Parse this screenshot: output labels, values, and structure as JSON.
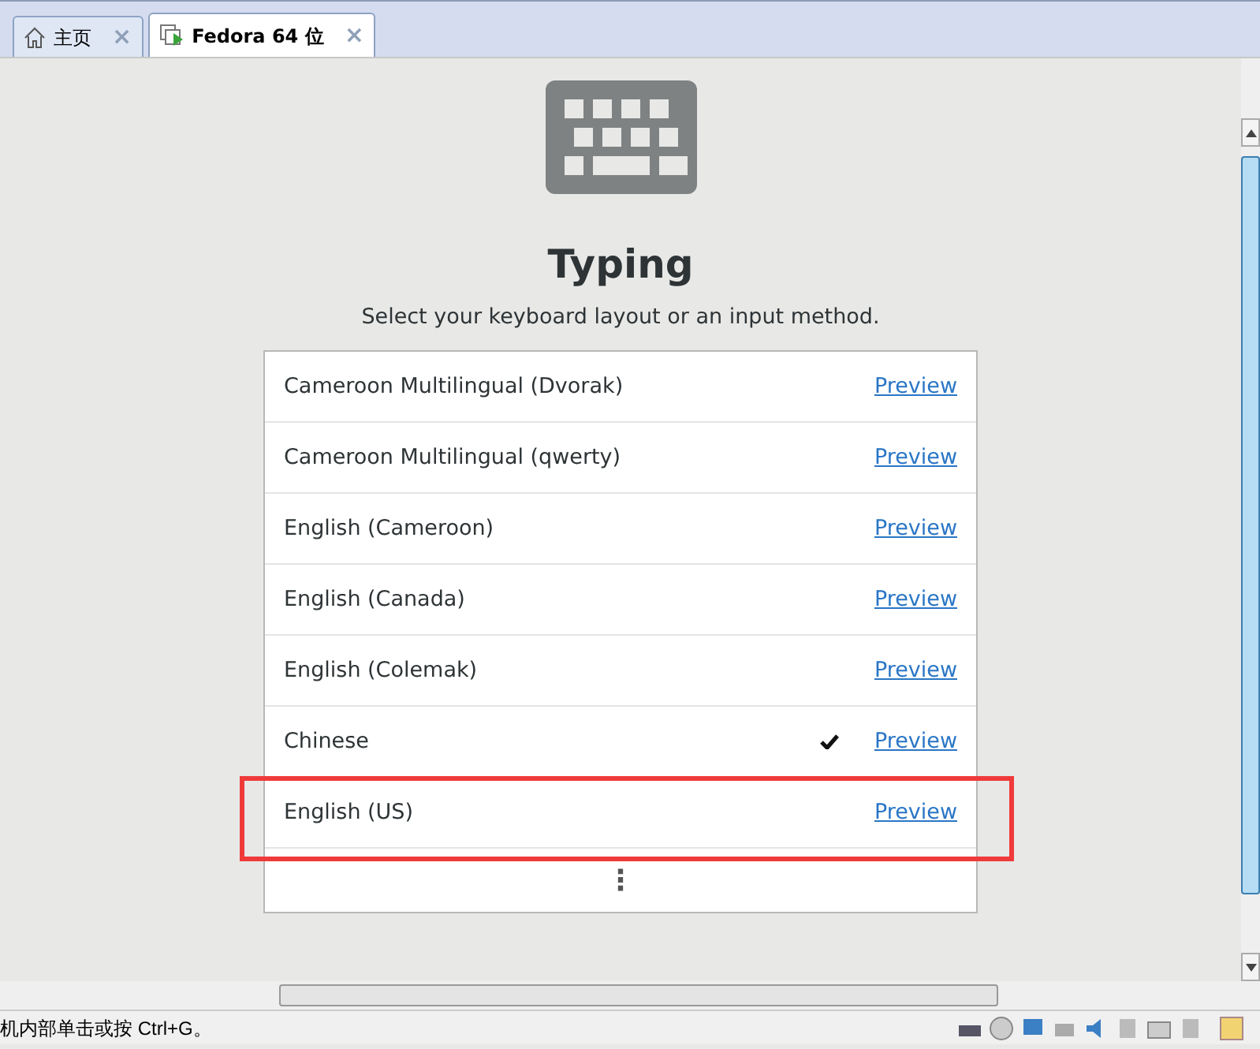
{
  "tabs": [
    {
      "label": "主页",
      "selected": false,
      "close": "×"
    },
    {
      "label": "Fedora 64 位",
      "selected": true,
      "close": "×"
    }
  ],
  "heading": "Typing",
  "subtitle": "Select your keyboard layout or an input method.",
  "layouts": [
    {
      "name": "Cameroon Multilingual (Dvorak)",
      "checked": false,
      "preview": "Preview",
      "highlighted": false
    },
    {
      "name": "Cameroon Multilingual (qwerty)",
      "checked": false,
      "preview": "Preview",
      "highlighted": false
    },
    {
      "name": "English (Cameroon)",
      "checked": false,
      "preview": "Preview",
      "highlighted": false
    },
    {
      "name": "English (Canada)",
      "checked": false,
      "preview": "Preview",
      "highlighted": false
    },
    {
      "name": "English (Colemak)",
      "checked": false,
      "preview": "Preview",
      "highlighted": false
    },
    {
      "name": "Chinese",
      "checked": true,
      "preview": "Preview",
      "highlighted": false
    },
    {
      "name": "English (US)",
      "checked": false,
      "preview": "Preview",
      "highlighted": true
    }
  ],
  "more": "⋮",
  "status_bar": {
    "text": "机内部单击或按 Ctrl+G。"
  }
}
